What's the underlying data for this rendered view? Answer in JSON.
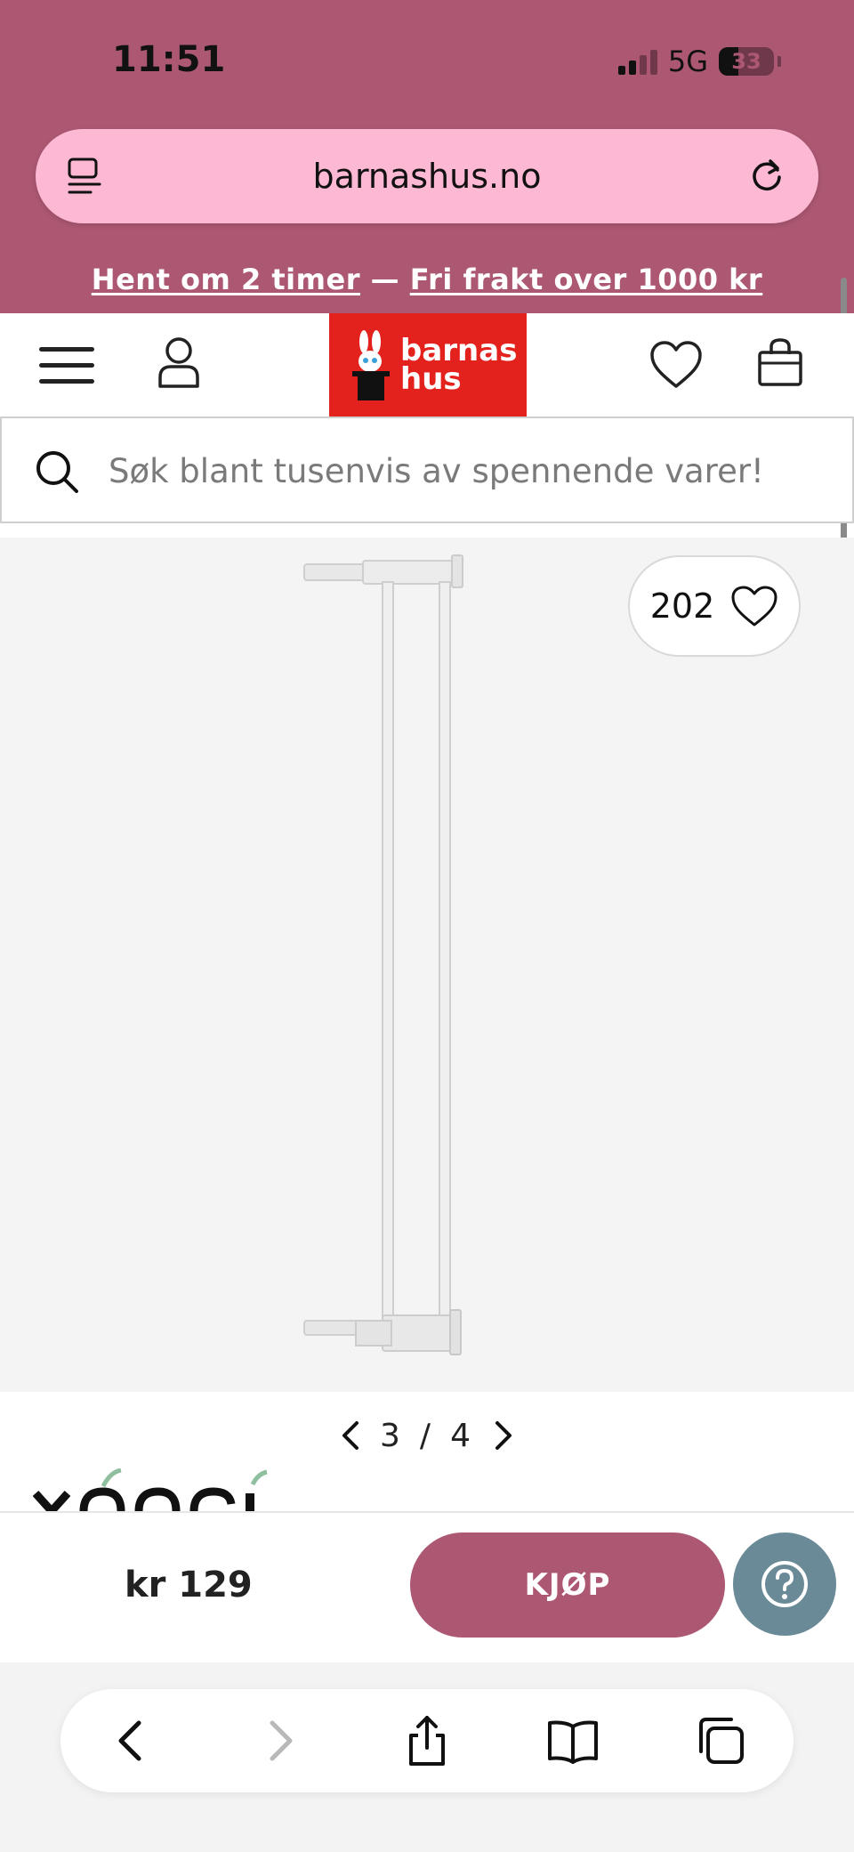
{
  "status_bar": {
    "time": "11:51",
    "network": "5G",
    "battery": "33"
  },
  "browser": {
    "url": "barnashus.no"
  },
  "promo": {
    "part1": "Hent om 2 timer",
    "separator": "—",
    "part2": "Fri frakt over 1000 kr"
  },
  "header": {
    "logo_line1": "barnas",
    "logo_line2": "hus",
    "logo_color": "#e3221d"
  },
  "search": {
    "placeholder": "Søk blant tusenvis av spennende varer!"
  },
  "gallery": {
    "likes": "202",
    "current": "3",
    "separator": "/",
    "total": "4"
  },
  "buy_bar": {
    "price": "kr 129",
    "buy_label": "KJØP"
  },
  "colors": {
    "accent": "#ad5873",
    "url_bar": "#fdb8d4",
    "help": "#6b8a98"
  }
}
